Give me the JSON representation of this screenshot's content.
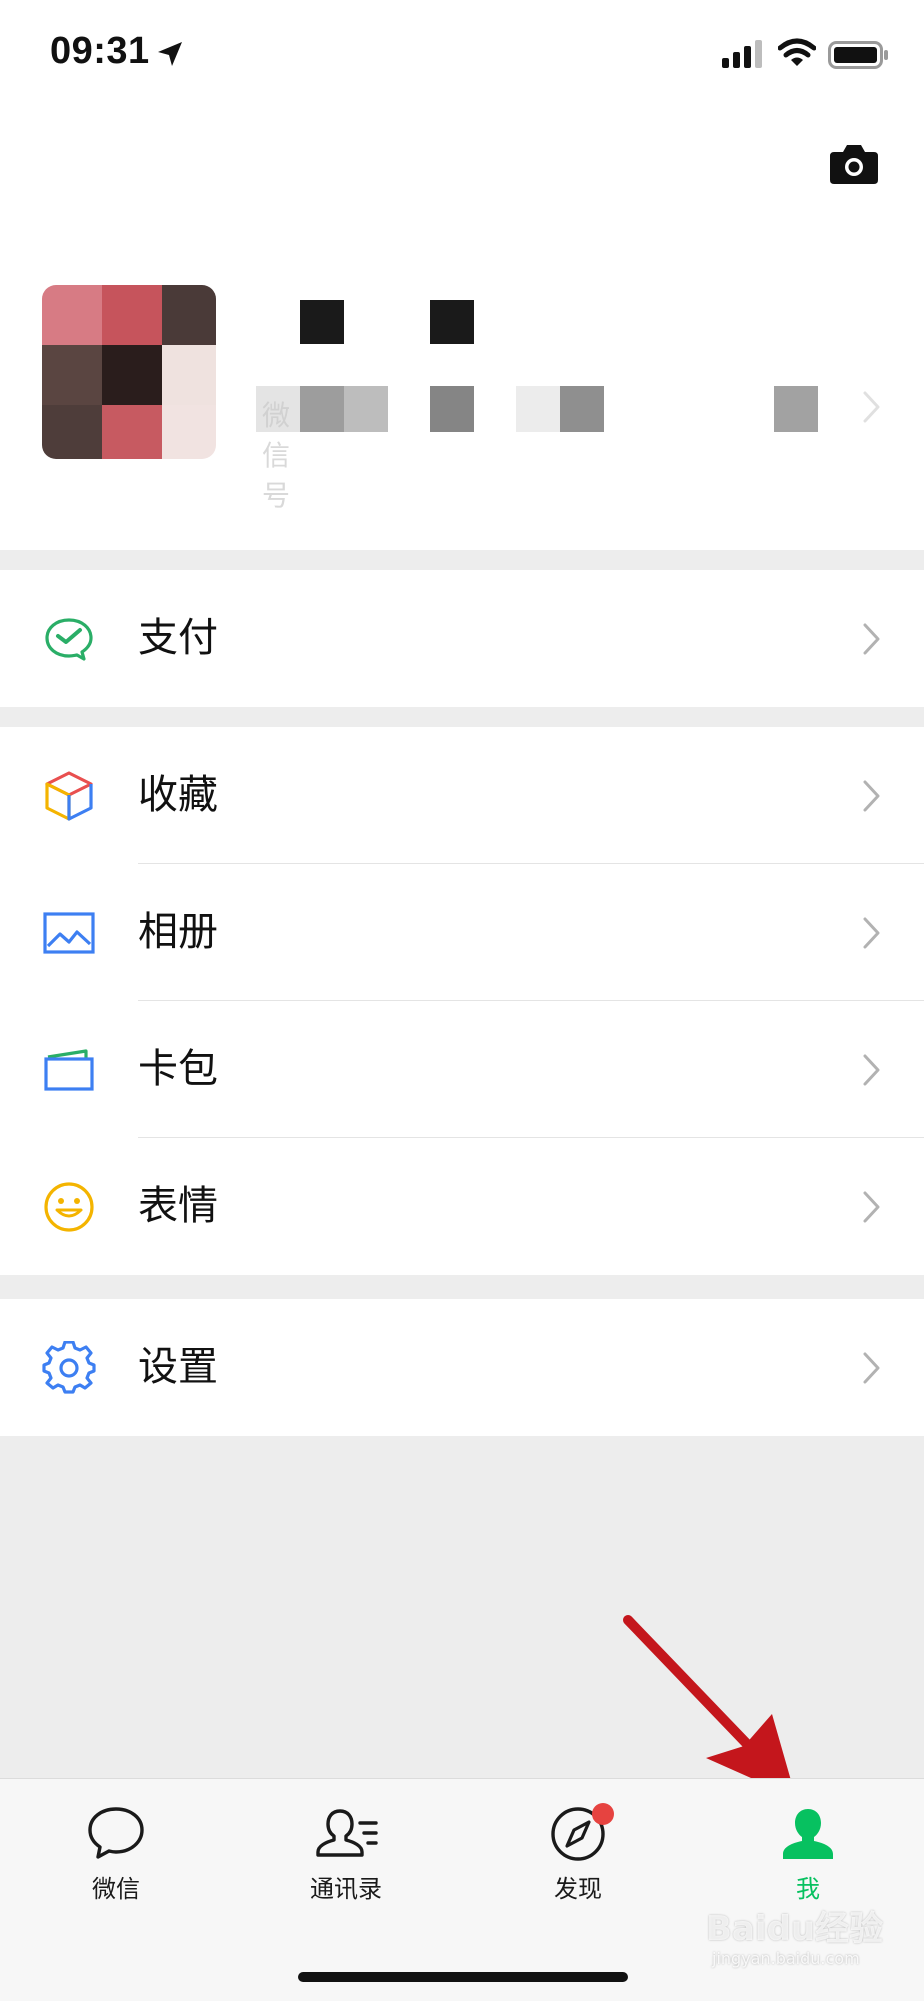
{
  "status_bar": {
    "time": "09:31",
    "location_icon": "location-arrow-icon",
    "signal_icon": "cellular-signal-icon",
    "wifi_icon": "wifi-icon",
    "battery_icon": "battery-icon"
  },
  "profile": {
    "camera_icon": "camera-icon",
    "wechat_id_label": "微信号"
  },
  "menu": {
    "pay": {
      "label": "支付",
      "icon": "wechat-pay-icon"
    },
    "favorites": {
      "label": "收藏",
      "icon": "cube-icon"
    },
    "album": {
      "label": "相册",
      "icon": "image-icon"
    },
    "cards": {
      "label": "卡包",
      "icon": "card-wallet-icon"
    },
    "stickers": {
      "label": "表情",
      "icon": "smiley-icon"
    },
    "settings": {
      "label": "设置",
      "icon": "gear-icon"
    }
  },
  "tab_bar": {
    "tabs": [
      {
        "label": "微信",
        "icon": "chat-bubble-icon"
      },
      {
        "label": "通讯录",
        "icon": "contacts-icon"
      },
      {
        "label": "发现",
        "icon": "compass-icon",
        "badge": true
      },
      {
        "label": "我",
        "icon": "person-icon",
        "active": true
      }
    ]
  },
  "watermark": {
    "text": "Baidu经验",
    "sub": "jingyan.baidu.com"
  },
  "colors": {
    "accent_green": "#07c160",
    "badge_red": "#e64340",
    "annotation_arrow": "#c4161c",
    "background": "#ededed"
  }
}
